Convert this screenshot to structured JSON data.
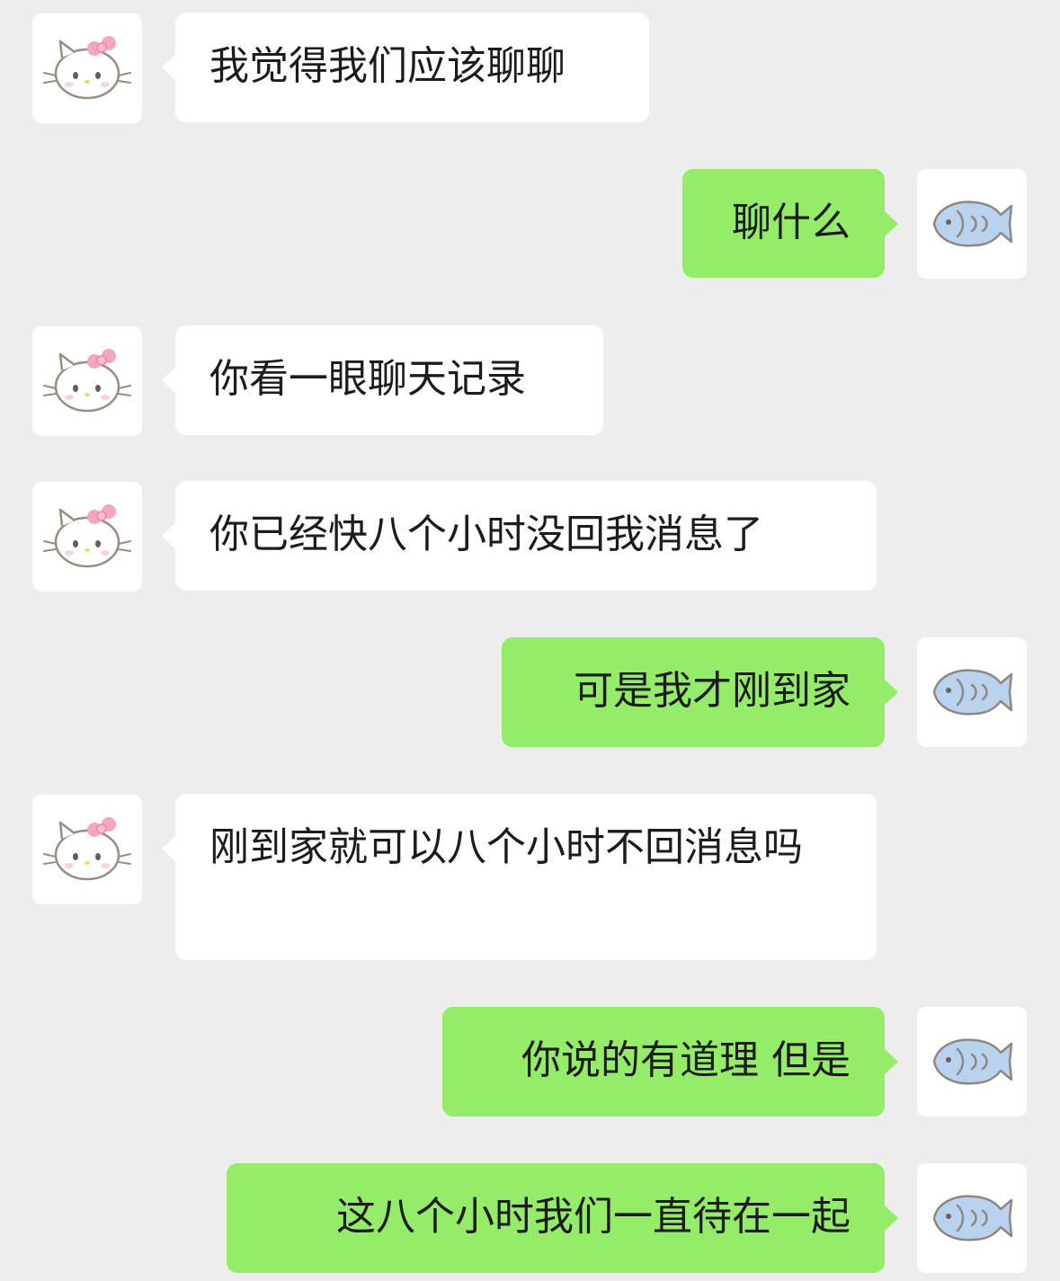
{
  "chat": {
    "messages": [
      {
        "side": "left",
        "avatar": "hello-kitty-icon",
        "text": "我觉得我们应该聊聊"
      },
      {
        "side": "right",
        "avatar": "fish-icon",
        "text": "聊什么"
      },
      {
        "side": "left",
        "avatar": "hello-kitty-icon",
        "text": "你看一眼聊天记录"
      },
      {
        "side": "left",
        "avatar": "hello-kitty-icon",
        "text": "你已经快八个小时没回我消息了"
      },
      {
        "side": "right",
        "avatar": "fish-icon",
        "text": "可是我才刚到家"
      },
      {
        "side": "left",
        "avatar": "hello-kitty-icon",
        "text": "刚到家就可以八个小时不回消息吗"
      },
      {
        "side": "right",
        "avatar": "fish-icon",
        "text": "你说的有道理 但是"
      },
      {
        "side": "right",
        "avatar": "fish-icon",
        "text": "这八个小时我们一直待在一起"
      }
    ]
  },
  "colors": {
    "background": "#ededed",
    "received_bubble": "#ffffff",
    "sent_bubble": "#95ec69",
    "text": "#1c1c1c",
    "kitty_bow": "#f4a6bd",
    "fish_body": "#b9d3ee"
  }
}
